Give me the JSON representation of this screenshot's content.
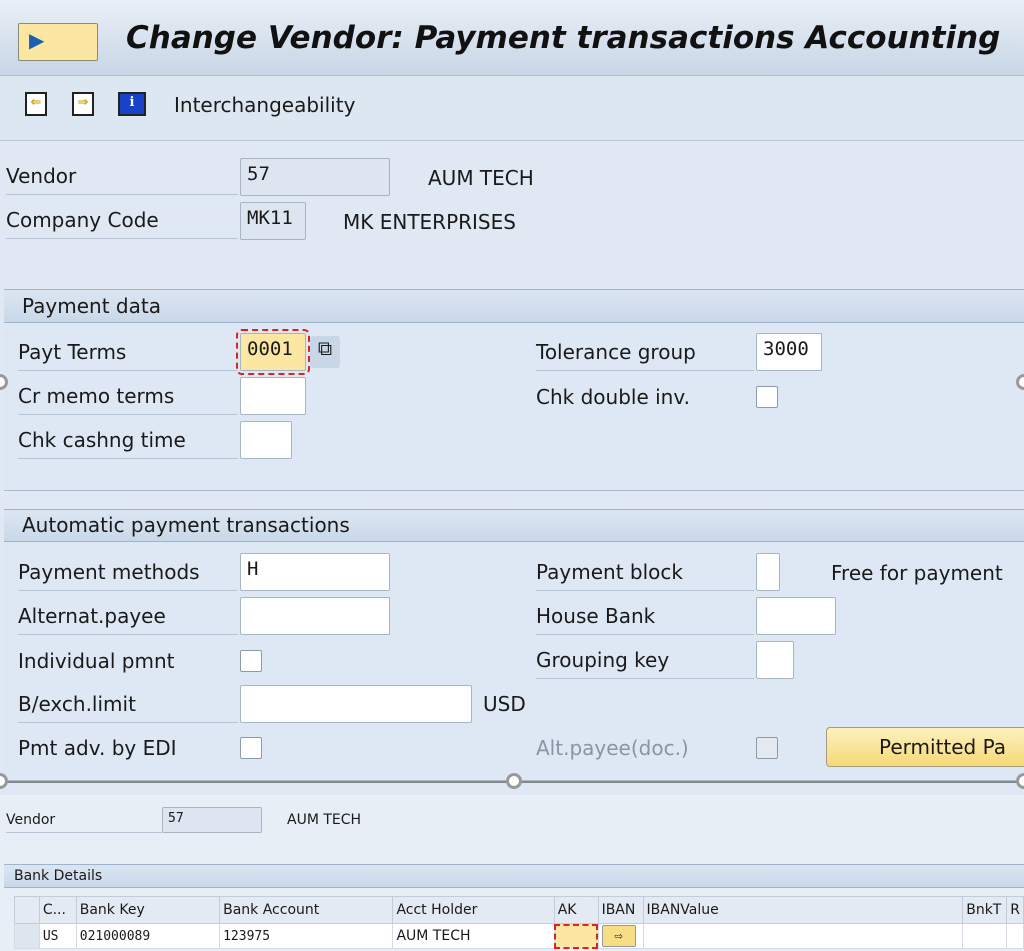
{
  "title": "Change Vendor: Payment transactions Accounting",
  "toolbar": {
    "prev_icon": "previous-screen-icon",
    "next_icon": "next-screen-icon",
    "info_icon": "info-icon",
    "interchangeability": "Interchangeability"
  },
  "header": {
    "vendor_label": "Vendor",
    "vendor_value": "57",
    "vendor_name": "AUM TECH",
    "company_label": "Company Code",
    "company_value": "MK11",
    "company_name": "MK ENTERPRISES"
  },
  "payment_data": {
    "title": "Payment data",
    "payt_terms_label": "Payt Terms",
    "payt_terms_value": "0001",
    "cr_memo_label": "Cr memo terms",
    "cr_memo_value": "",
    "chk_cash_label": "Chk cashng time",
    "chk_cash_value": "",
    "tolerance_label": "Tolerance group",
    "tolerance_value": "3000",
    "chk_double_label": "Chk double inv.",
    "chk_double_checked": false
  },
  "auto_payment": {
    "title": "Automatic payment transactions",
    "methods_label": "Payment methods",
    "methods_value": "H",
    "alt_payee_label": "Alternat.payee",
    "alt_payee_value": "",
    "individual_label": "Individual pmnt",
    "individual_checked": false,
    "bexch_label": "B/exch.limit",
    "bexch_value": "",
    "currency": "USD",
    "edi_label": "Pmt adv. by EDI",
    "edi_checked": false,
    "block_label": "Payment block",
    "block_value": "",
    "block_text": "Free for payment",
    "house_bank_label": "House Bank",
    "house_bank_value": "",
    "grouping_label": "Grouping key",
    "grouping_value": "",
    "alt_doc_label": "Alt.payee(doc.)",
    "alt_doc_checked": false,
    "permitted_button": "Permitted Pa"
  },
  "lower": {
    "vendor_label": "Vendor",
    "vendor_value": "57",
    "vendor_name": "AUM TECH"
  },
  "bank_details": {
    "title": "Bank Details",
    "columns": [
      "C...",
      "Bank Key",
      "Bank Account",
      "Acct Holder",
      "AK",
      "IBAN",
      "IBANValue",
      "BnkT",
      "R"
    ],
    "rows": [
      [
        "US",
        "021000089",
        "123975",
        "AUM TECH",
        "",
        "",
        "",
        "",
        ""
      ]
    ]
  }
}
